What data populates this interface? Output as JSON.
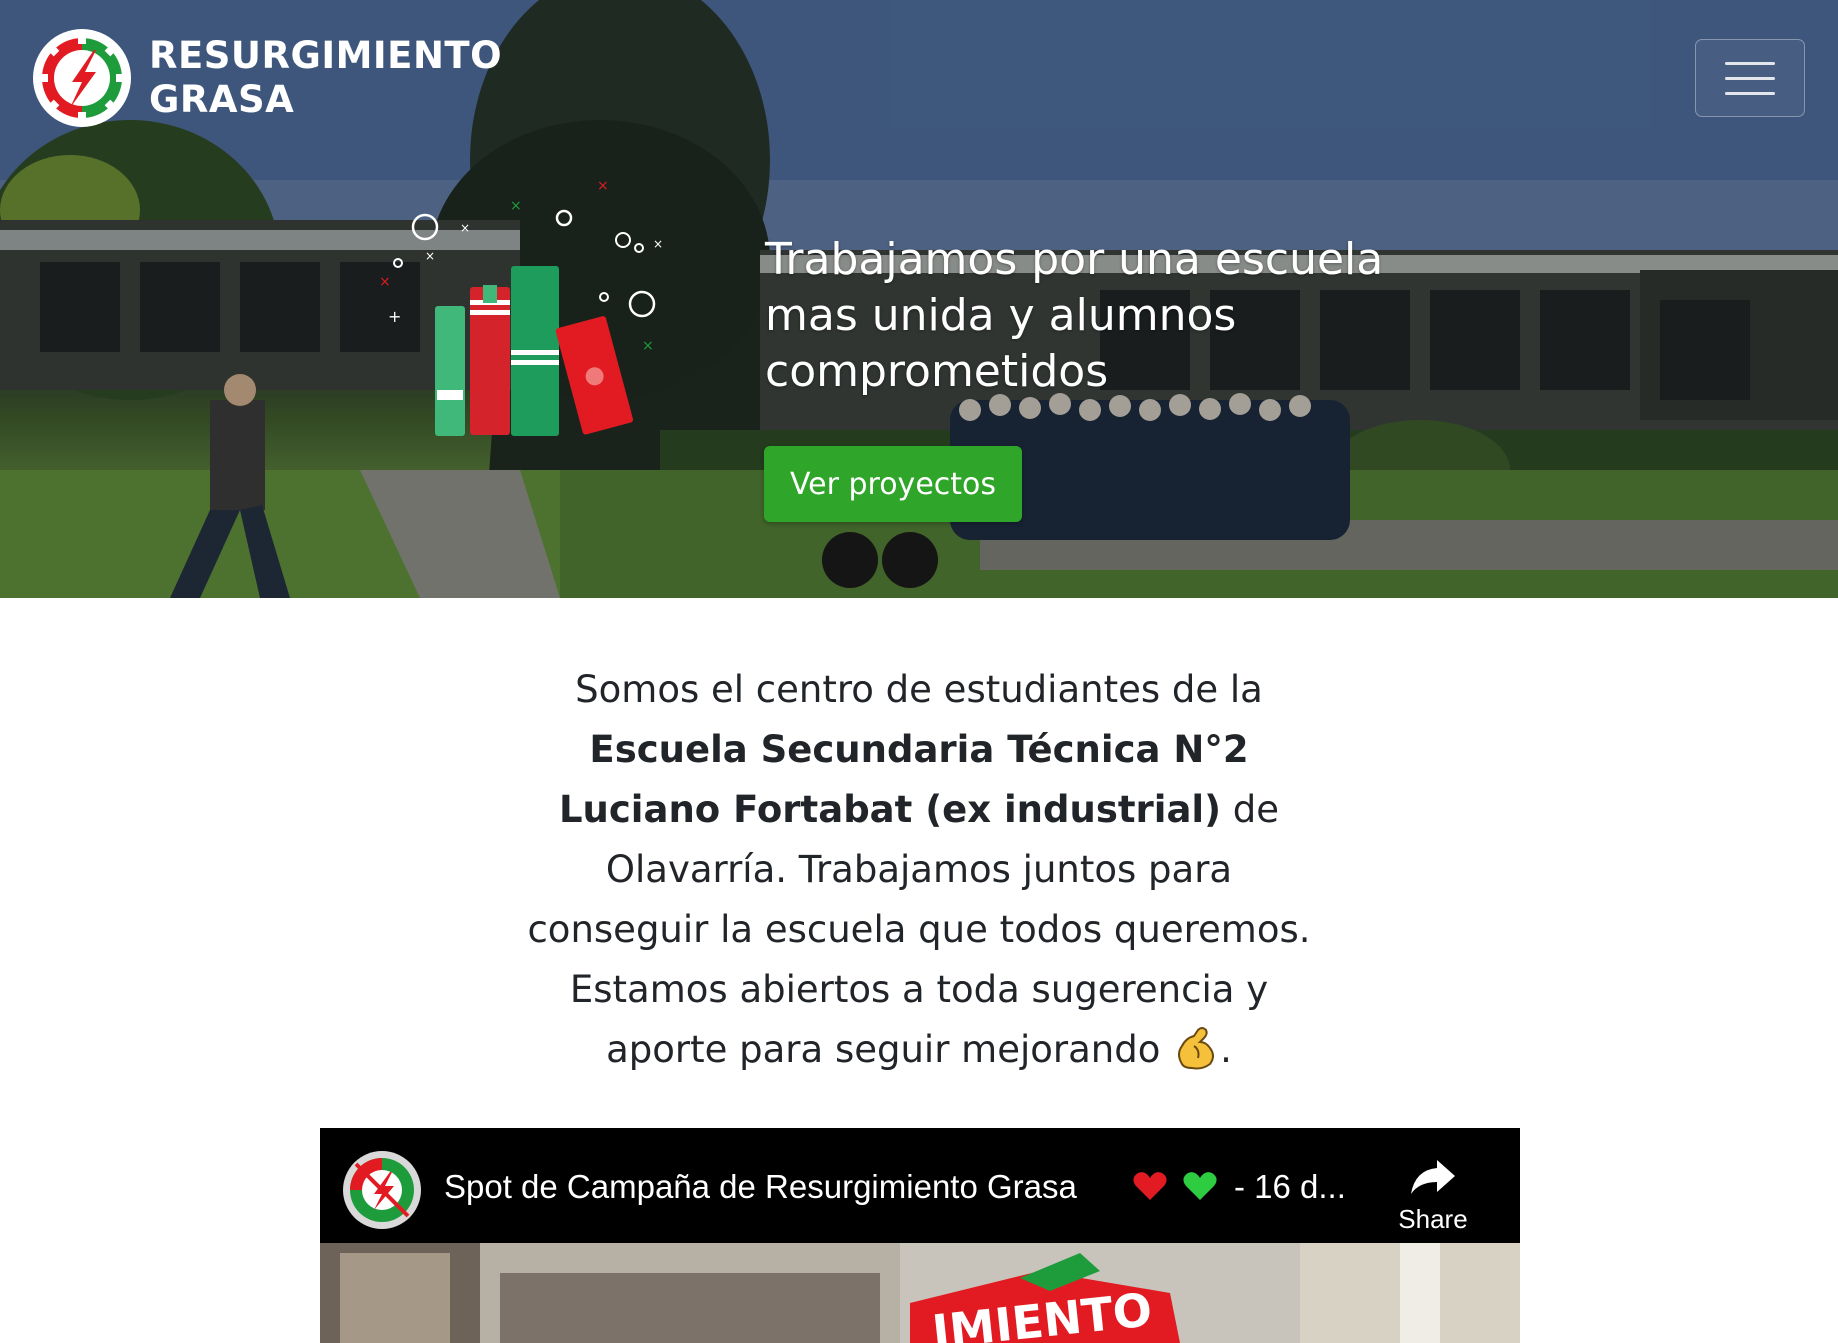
{
  "navbar": {
    "brand_line1": "RESURGIMIENTO",
    "brand_line2": "GRASA",
    "logo_icon": "gear-lightning-logo-icon",
    "menu_icon": "hamburger-icon"
  },
  "hero": {
    "title": "Trabajamos por una escuela mas unida y alumnos comprometidos",
    "cta_label": "Ver proyectos",
    "cta_color": "#2fa52a",
    "illustration_icon": "books-illustration-icon"
  },
  "about": {
    "intro": "Somos el centro de estudiantes de la",
    "school_name": "Escuela Secundaria Técnica N°2 Luciano Fortabat (ex industrial)",
    "city": " de Olavarría.",
    "body": "Trabajamos juntos para conseguir la escuela que todos queremos. Estamos abiertos a toda sugerencia y aporte para seguir mejorando ",
    "end": ".",
    "emoji_icon": "flexed-biceps-icon"
  },
  "video": {
    "title": "Spot de Campaña de Resurgimiento Grasa",
    "title_suffix": "- 16 d...",
    "hearts": [
      "red-heart-icon",
      "green-heart-icon"
    ],
    "share_label": "Share",
    "share_icon": "share-arrow-icon",
    "thumbnail_text": "IMIENTO",
    "colors": {
      "red": "#e21b23",
      "green": "#1e9c3c"
    }
  }
}
